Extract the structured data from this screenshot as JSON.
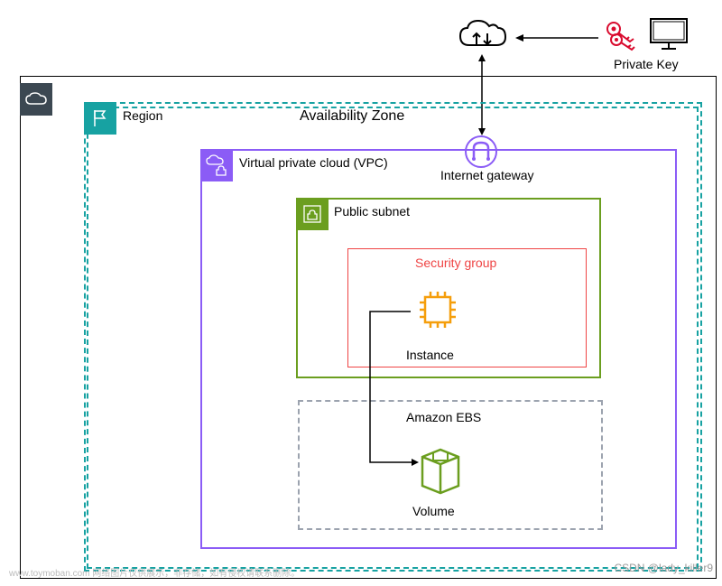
{
  "labels": {
    "region": "Region",
    "availability_zone": "Availability Zone",
    "vpc": "Virtual private cloud (VPC)",
    "internet_gateway": "Internet gateway",
    "public_subnet": "Public subnet",
    "security_group": "Security group",
    "instance": "Instance",
    "amazon_ebs": "Amazon EBS",
    "volume": "Volume",
    "private_key": "Private Key"
  },
  "watermarks": {
    "footer": "www.toymoban.com 网络图片仅供展示，非存储，如有侵权请联系删除。",
    "csdn": "CSDN @lady_killer9"
  },
  "colors": {
    "outer": "#000000",
    "region": "#17a2a2",
    "vpc": "#8b5cf6",
    "subnet": "#6b9e1f",
    "security_group": "#ef4444",
    "ebs_dash": "#9ca3af",
    "cloud_badge": "#3c4852",
    "instance_accent": "#f59e0b",
    "key": "#d90b2e"
  }
}
